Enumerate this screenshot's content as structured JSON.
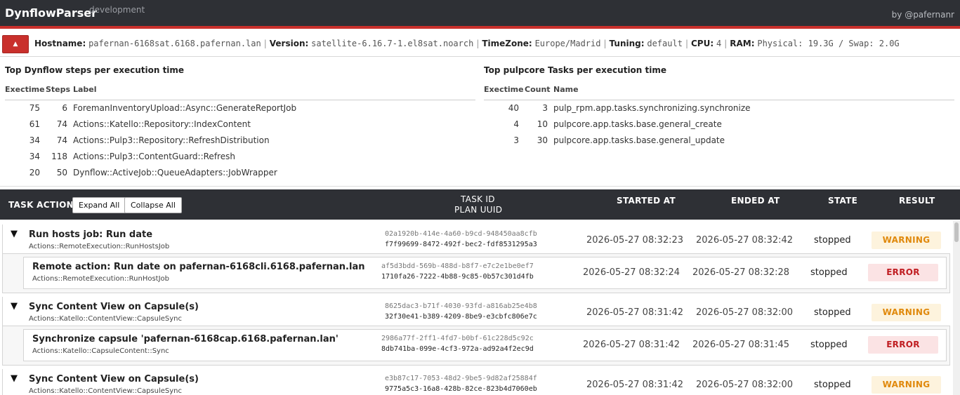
{
  "header": {
    "brand": "DynflowParser",
    "env": "development",
    "byline": "by @pafernanr"
  },
  "info": {
    "toggle_icon": "▲",
    "hostname_label": "Hostname:",
    "hostname": "pafernan-6168sat.6168.pafernan.lan",
    "version_label": "Version:",
    "version": "satellite-6.16.7-1.el8sat.noarch",
    "timezone_label": "TimeZone:",
    "timezone": "Europe/Madrid",
    "tuning_label": "Tuning:",
    "tuning": "default",
    "cpu_label": "CPU:",
    "cpu": "4",
    "ram_label": "RAM:",
    "ram": "Physical: 19.3G / Swap: 2.0G",
    "separator": "|"
  },
  "dynflow_stats": {
    "title": "Top Dynflow steps per execution time",
    "columns": [
      "Exectime",
      "Steps",
      "Label"
    ],
    "rows": [
      {
        "exectime": "75",
        "steps": "6",
        "label": "ForemanInventoryUpload::Async::GenerateReportJob"
      },
      {
        "exectime": "61",
        "steps": "74",
        "label": "Actions::Katello::Repository::IndexContent"
      },
      {
        "exectime": "34",
        "steps": "74",
        "label": "Actions::Pulp3::Repository::RefreshDistribution"
      },
      {
        "exectime": "34",
        "steps": "118",
        "label": "Actions::Pulp3::ContentGuard::Refresh"
      },
      {
        "exectime": "20",
        "steps": "50",
        "label": "Dynflow::ActiveJob::QueueAdapters::JobWrapper"
      }
    ]
  },
  "pulp_stats": {
    "title": "Top pulpcore Tasks per execution time",
    "columns": [
      "Exectime",
      "Count",
      "Name"
    ],
    "rows": [
      {
        "exectime": "40",
        "count": "3",
        "name": "pulp_rpm.app.tasks.synchronizing.synchronize"
      },
      {
        "exectime": "4",
        "count": "10",
        "name": "pulpcore.app.tasks.base.general_create"
      },
      {
        "exectime": "3",
        "count": "30",
        "name": "pulpcore.app.tasks.base.general_update"
      }
    ]
  },
  "tasks": {
    "header": {
      "task_action": "TASK ACTION",
      "expand_all": "Expand All",
      "collapse_all": "Collapse All",
      "task_id": "TASK ID",
      "plan_uuid": "PLAN UUID",
      "started_at": "STARTED AT",
      "ended_at": "ENDED AT",
      "state": "STATE",
      "result": "RESULT"
    },
    "rows": [
      {
        "level": 0,
        "title": "Run hosts job: Run date",
        "action": "Actions::RemoteExecution::RunHostsJob",
        "task_id": "02a1920b-414e-4a60-b9cd-948450aa8cfb",
        "plan_uuid": "f7f99699-8472-492f-bec2-fdf8531295a3",
        "started": "2026-05-27 08:32:23",
        "ended": "2026-05-27 08:32:42",
        "state": "stopped",
        "result": "WARNING"
      },
      {
        "level": 1,
        "title": "Remote action: Run date on pafernan-6168cli.6168.pafernan.lan",
        "action": "Actions::RemoteExecution::RunHostJob",
        "task_id": "af5d3bdd-569b-488d-b8f7-e7c2e1be0ef7",
        "plan_uuid": "1710fa26-7222-4b88-9c85-0b57c301d4fb",
        "started": "2026-05-27 08:32:24",
        "ended": "2026-05-27 08:32:28",
        "state": "stopped",
        "result": "ERROR"
      },
      {
        "level": 0,
        "title": "Sync Content View on Capsule(s)",
        "action": "Actions::Katello::ContentView::CapsuleSync",
        "task_id": "8625dac3-b71f-4030-93fd-a816ab25e4b8",
        "plan_uuid": "32f30e41-b389-4209-8be9-e3cbfc806e7c",
        "started": "2026-05-27 08:31:42",
        "ended": "2026-05-27 08:32:00",
        "state": "stopped",
        "result": "WARNING"
      },
      {
        "level": 1,
        "title": "Synchronize capsule 'pafernan-6168cap.6168.pafernan.lan'",
        "action": "Actions::Katello::CapsuleContent::Sync",
        "task_id": "2986a77f-2ff1-4fd7-b0bf-61c228d5c92c",
        "plan_uuid": "8db741ba-099e-4cf3-972a-ad92a4f2ec9d",
        "started": "2026-05-27 08:31:42",
        "ended": "2026-05-27 08:31:45",
        "state": "stopped",
        "result": "ERROR"
      },
      {
        "level": 0,
        "title": "Sync Content View on Capsule(s)",
        "action": "Actions::Katello::ContentView::CapsuleSync",
        "task_id": "e3b87c17-7053-48d2-9be5-9d82af25884f",
        "plan_uuid": "9775a5c3-16a8-428b-82ce-823b4d7060eb",
        "started": "2026-05-27 08:31:42",
        "ended": "2026-05-27 08:32:00",
        "state": "stopped",
        "result": "WARNING"
      }
    ]
  },
  "colors": {
    "topbar": "#2e3035",
    "accent_red": "#c9302c",
    "warning": "#e0890c",
    "error": "#c01e22"
  }
}
